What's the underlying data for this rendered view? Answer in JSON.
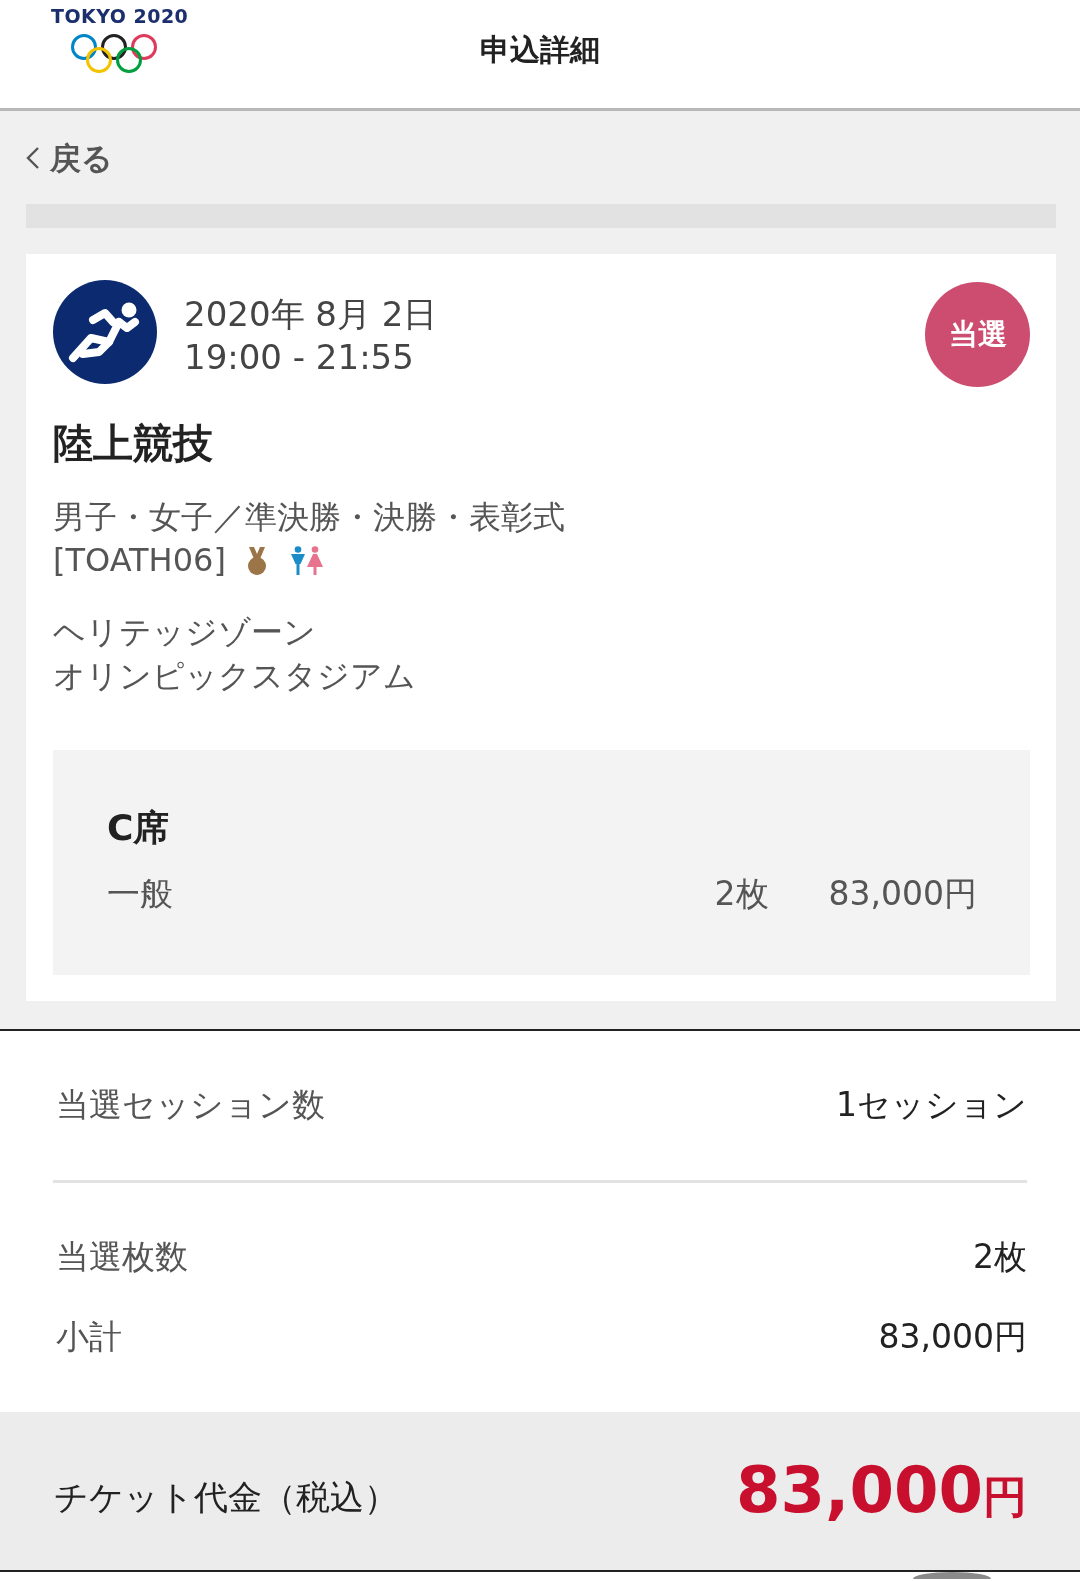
{
  "header": {
    "logo_text": "TOKYO 2020",
    "title": "申込詳細"
  },
  "back_link": {
    "label": "戻る"
  },
  "session": {
    "date": "2020年 8月 2日",
    "time": "19:00 - 21:55",
    "status": "当選",
    "sport": "陸上競技",
    "description": "男子・女子／準決勝・決勝・表彰式",
    "code": "[TOATH06]",
    "venue": [
      "ヘリテッジゾーン",
      "オリンピックスタジアム"
    ],
    "seats": [
      {
        "seat_class": "C席",
        "tickets": [
          {
            "type": "一般",
            "count": "2枚",
            "price": "83,000円"
          }
        ]
      }
    ]
  },
  "session_count": {
    "label": "当選セッション数",
    "value": "1セッション"
  },
  "ticket_summary": [
    {
      "label": "当選枚数",
      "value": "2枚"
    },
    {
      "label": "小計",
      "value": "83,000円"
    }
  ],
  "total": {
    "label": "チケット代金（税込）",
    "amount": "83,000",
    "unit": "円"
  }
}
